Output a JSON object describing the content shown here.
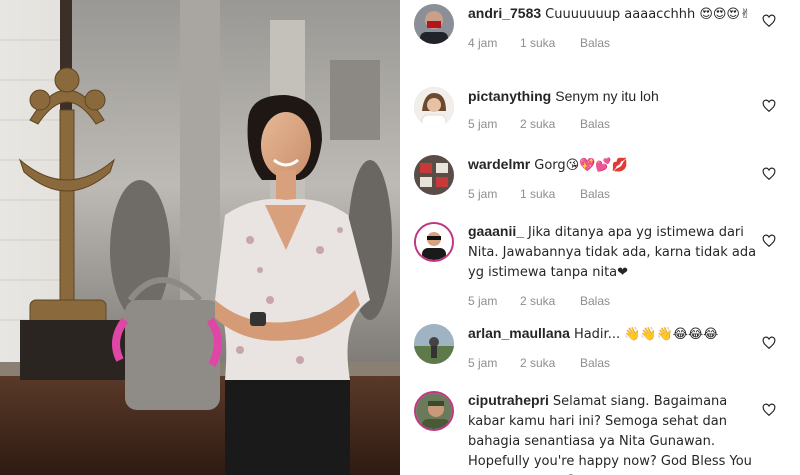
{
  "comments": [
    {
      "username": "andri_7583",
      "text": "Cuuuuuuup aaaacchhh 😍😍😍✌",
      "time": "4 jam",
      "likes": "1 suka",
      "reply": "Balas"
    },
    {
      "username": "pictanything",
      "text": "Senym ny itu loh",
      "time": "5 jam",
      "likes": "2 suka",
      "reply": "Balas"
    },
    {
      "username": "wardelmr",
      "text": "Gorg😘💖💕💋",
      "time": "5 jam",
      "likes": "1 suka",
      "reply": "Balas"
    },
    {
      "username": "gaaanii_",
      "text": "Jika ditanya apa yg istimewa dari Nita. Jawabannya tidak ada, karna tidak ada yg istimewa tanpa nita❤",
      "time": "5 jam",
      "likes": "2 suka",
      "reply": "Balas"
    },
    {
      "username": "arlan_maullana",
      "text": "Hadir... 👋👋👋😂😂😂",
      "time": "5 jam",
      "likes": "2 suka",
      "reply": "Balas"
    },
    {
      "username": "ciputrahepri",
      "text": "Selamat siang. Bagaimana kabar kamu hari ini? Semoga sehat dan bahagia senantiasa ya Nita Gunawan. Hopefully you're happy now? God Bless You Nita Gunawan 😊",
      "time": "",
      "likes": "",
      "reply": ""
    }
  ],
  "icons": {
    "like": "heart-outline-icon"
  },
  "colors": {
    "text": "#262626",
    "meta": "#8e8e8e",
    "story_ring": "#c13584"
  }
}
